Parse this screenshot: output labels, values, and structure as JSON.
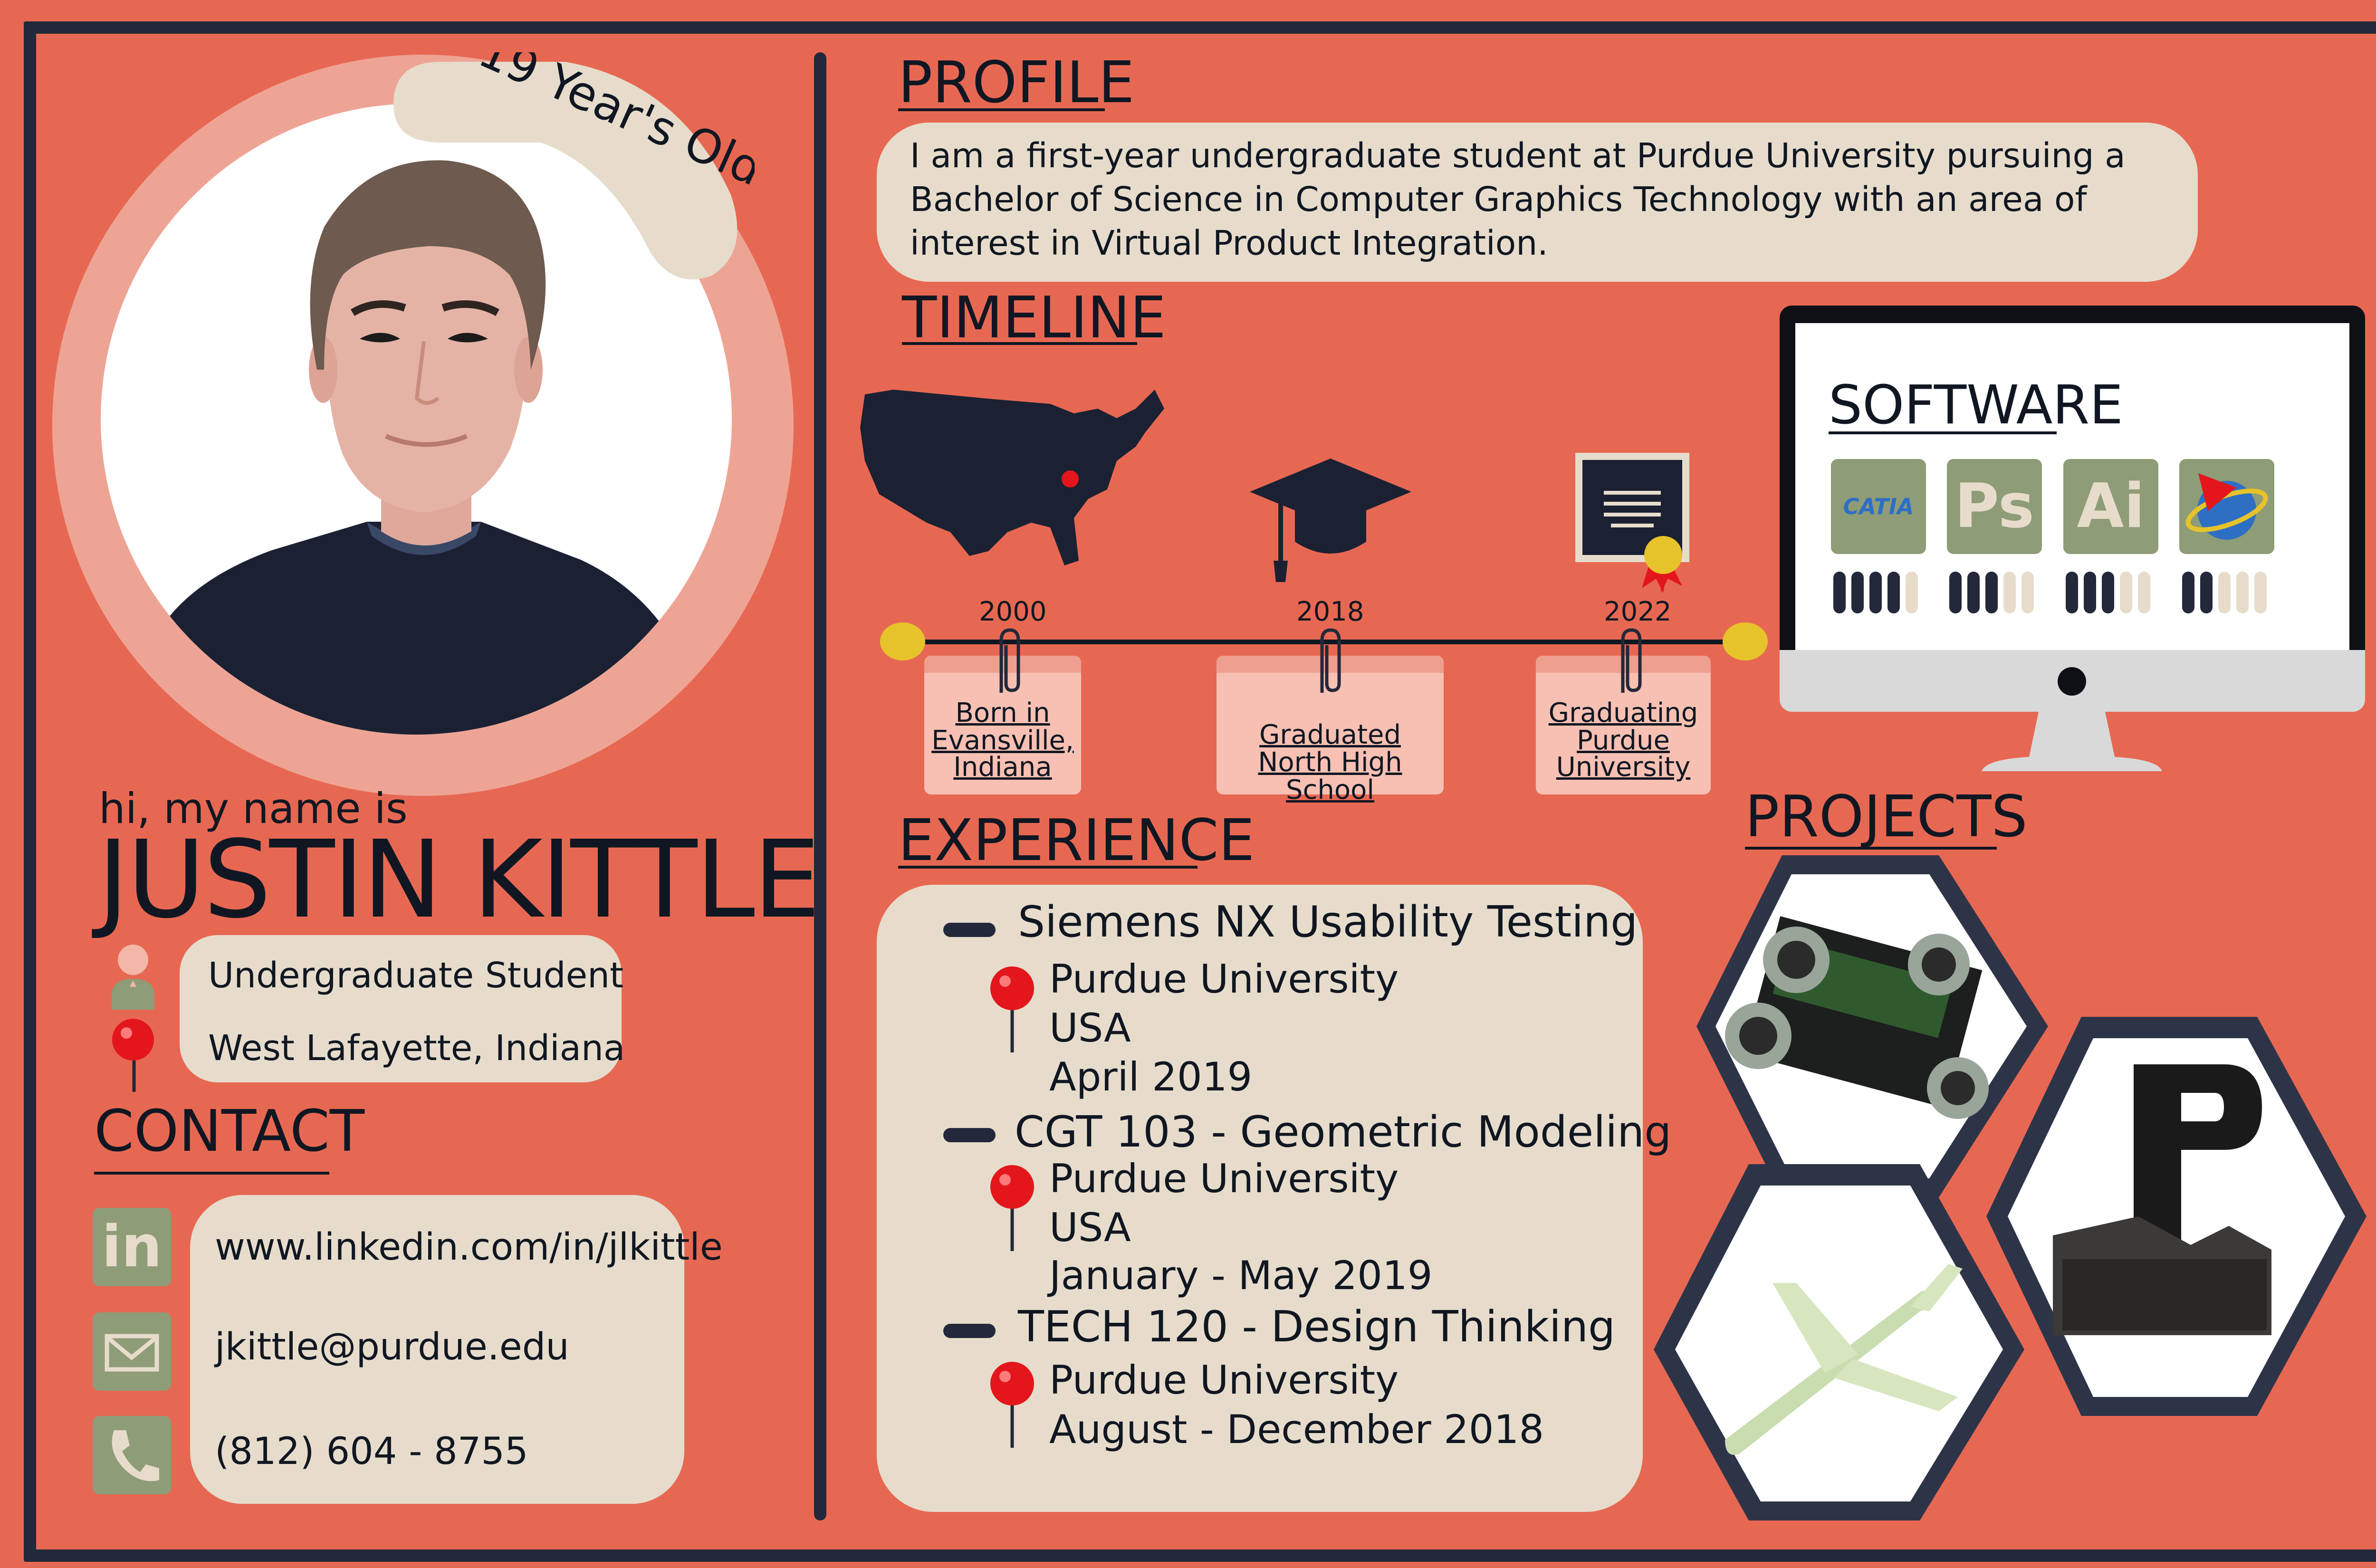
{
  "age": "19 Year's Old",
  "intro": "hi, my name is",
  "name": "JUSTIN KITTLE",
  "about": {
    "role": "Undergraduate Student",
    "location": "West Lafayette, Indiana"
  },
  "contact": {
    "title": "CONTACT",
    "linkedin": "www.linkedin.com/in/jlkittle",
    "email": "jkittle@purdue.edu",
    "phone": "(812) 604 - 8755",
    "linkedin_icon_text": "in"
  },
  "profile": {
    "title": "PROFILE",
    "text": "I am a first-year undergraduate student at Purdue University pursuing a Bachelor of Science in Computer Graphics Technology with an area of interest in Virtual Product Integration."
  },
  "timeline": {
    "title": "TIMELINE",
    "events": [
      {
        "year": "2000",
        "lines": [
          "Born in",
          "Evansville,",
          "Indiana"
        ]
      },
      {
        "year": "2018",
        "lines": [
          "Graduated",
          "North High School"
        ]
      },
      {
        "year": "2022",
        "lines": [
          "Graduating",
          "Purdue",
          "University"
        ]
      }
    ]
  },
  "software": {
    "title": "SOFTWARE",
    "items": [
      {
        "label": "CATIA",
        "icon": "catia-icon",
        "level": 0.8
      },
      {
        "label": "Ps",
        "icon": "photoshop-icon",
        "level": 0.6
      },
      {
        "label": "Ai",
        "icon": "illustrator-icon",
        "level": 0.6
      },
      {
        "label": "",
        "icon": "siemens-nx-icon",
        "level": 0.4
      }
    ]
  },
  "experience": {
    "title": "EXPERIENCE",
    "entries": [
      {
        "title": "Siemens NX Usability Testing",
        "org": "Purdue University",
        "country": "USA",
        "date": "April 2019"
      },
      {
        "title": "CGT 103 - Geometric Modeling",
        "org": "Purdue University",
        "country": "USA",
        "date": "January - May 2019"
      },
      {
        "title": "TECH 120 - Design Thinking",
        "org": "Purdue University",
        "date": "August - December 2018"
      }
    ]
  },
  "projects": {
    "title": "PROJECTS",
    "items": [
      "robot-chassis-render",
      "block-letter-p-render",
      "airplane-render"
    ]
  },
  "colors": {
    "background": "#E76852",
    "navy": "#23283A",
    "cream": "#E7DCCB",
    "sage": "#8E9C77",
    "gold": "#E6C32A",
    "pin_red": "#E3161B"
  }
}
